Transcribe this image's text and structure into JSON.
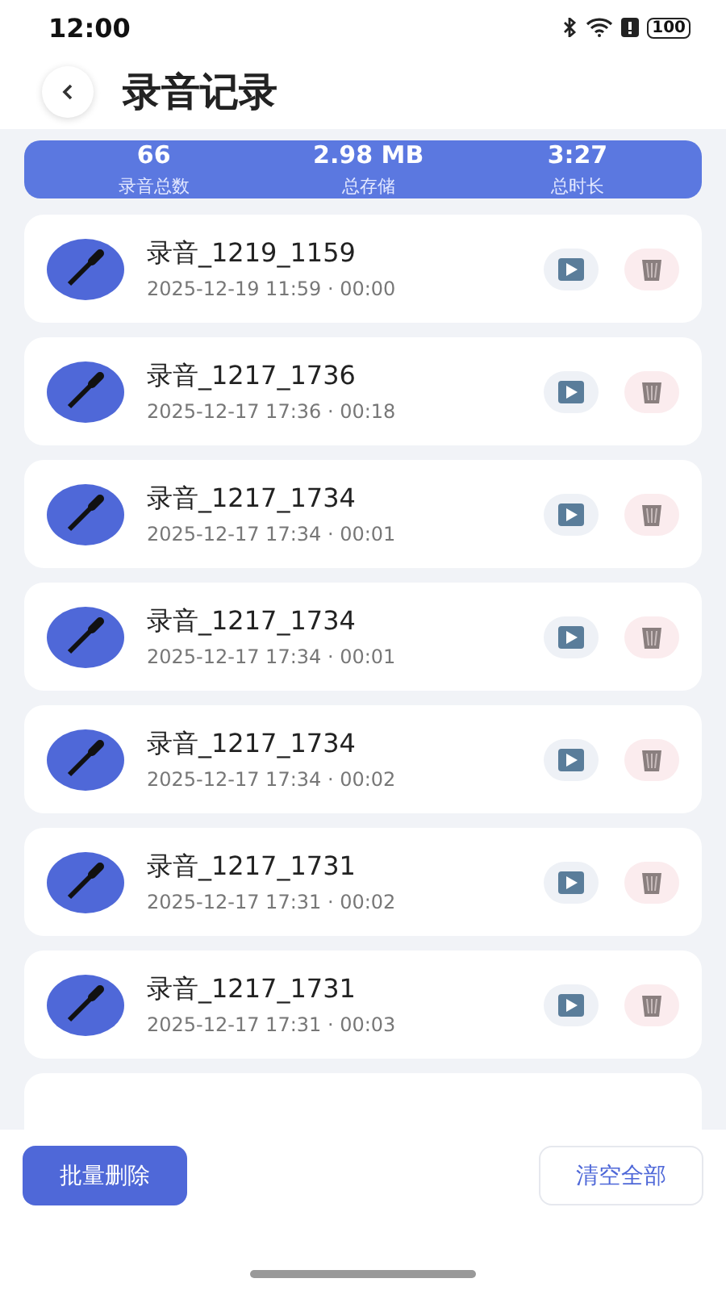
{
  "status_bar": {
    "time": "12:00",
    "battery": "100"
  },
  "header": {
    "title": "录音记录"
  },
  "stats": [
    {
      "value": "66",
      "label": "录音总数"
    },
    {
      "value": "2.98 MB",
      "label": "总存储"
    },
    {
      "value": "3:27",
      "label": "总时长"
    }
  ],
  "recordings": [
    {
      "name": "录音_1219_1159",
      "meta": "2025-12-19 11:59 · 00:00"
    },
    {
      "name": "录音_1217_1736",
      "meta": "2025-12-17 17:36 · 00:18"
    },
    {
      "name": "录音_1217_1734",
      "meta": "2025-12-17 17:34 · 00:01"
    },
    {
      "name": "录音_1217_1734",
      "meta": "2025-12-17 17:34 · 00:01"
    },
    {
      "name": "录音_1217_1734",
      "meta": "2025-12-17 17:34 · 00:02"
    },
    {
      "name": "录音_1217_1731",
      "meta": "2025-12-17 17:31 · 00:02"
    },
    {
      "name": "录音_1217_1731",
      "meta": "2025-12-17 17:31 · 00:03"
    }
  ],
  "bottom_bar": {
    "batch_delete": "批量删除",
    "clear_all": "清空全部"
  }
}
